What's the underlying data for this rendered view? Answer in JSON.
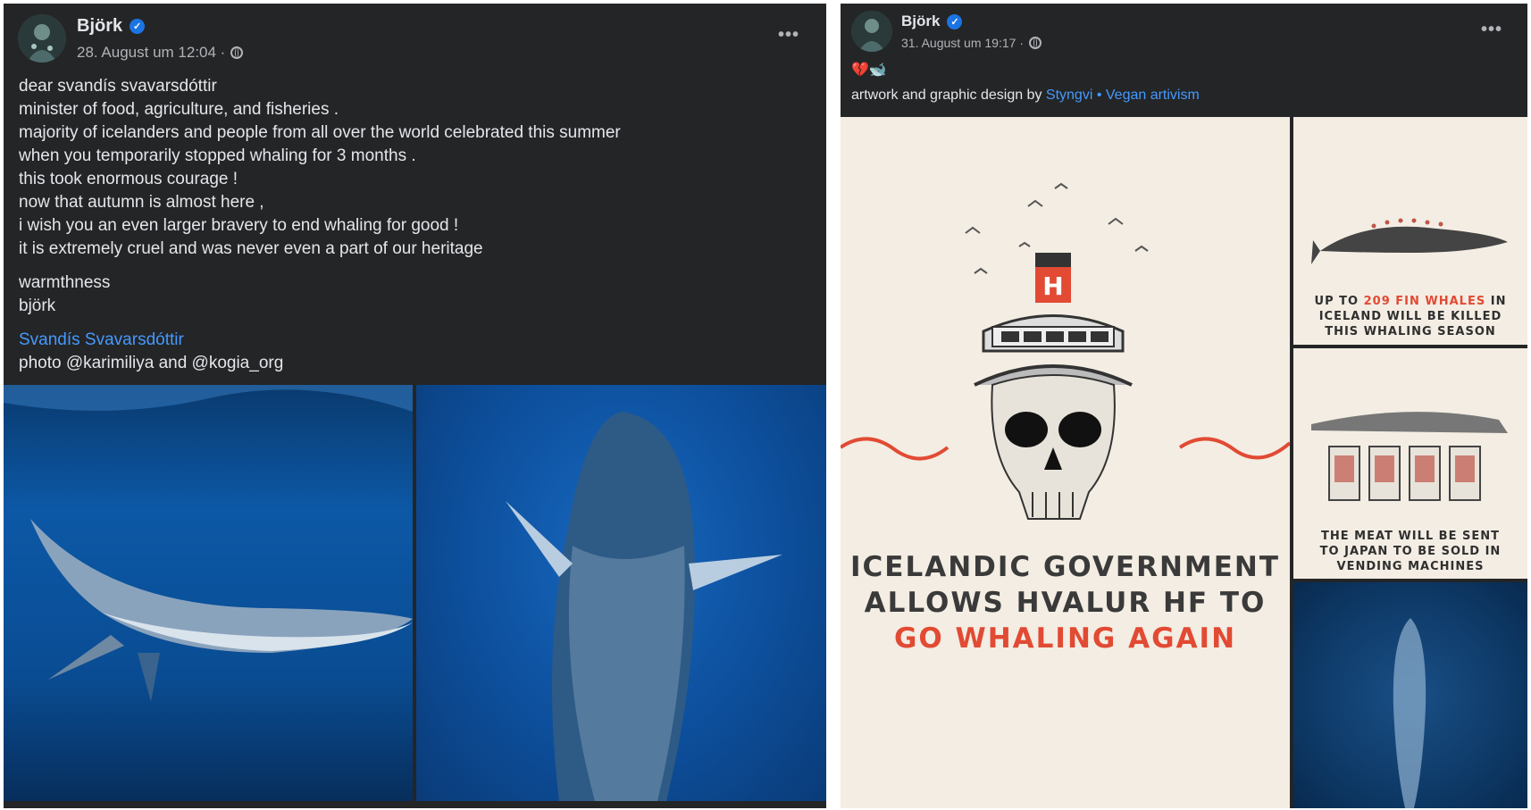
{
  "post1": {
    "author": "Björk",
    "timestamp": "28. August um 12:04 ·",
    "lines": [
      "dear svandís svavarsdóttir",
      "minister of food, agriculture, and fisheries .",
      "majority of icelanders and people from all over the world celebrated this summer",
      "when you temporarily stopped whaling for 3 months .",
      "this took enormous courage !",
      "now that autumn is almost here ,",
      "i wish you an even larger bravery to end whaling for good !",
      "it is extremely cruel and was never even a part of our heritage"
    ],
    "signoff": [
      "warmthness",
      "björk"
    ],
    "tag_link": "Svandís Svavarsdóttir",
    "photo_credit": "photo @karimiliya and @kogia_org"
  },
  "post2": {
    "author": "Björk",
    "timestamp": "31. August um 19:17 ·",
    "emoji": "💔🐋",
    "caption_prefix": "artwork and graphic design by ",
    "caption_link1": "Styngvi",
    "caption_sep": " • ",
    "caption_link2": "Vegan artivism",
    "poster": {
      "ship_letter": "H",
      "line1": "ICELANDIC GOVERNMENT",
      "line2": "ALLOWS HVALUR HF TO",
      "line3": "GO WHALING AGAIN"
    },
    "tile1": {
      "pre": "UP TO ",
      "highlight": "209 FIN WHALES",
      "post": " IN",
      "line2": "ICELAND WILL BE KILLED",
      "line3": "THIS WHALING SEASON"
    },
    "tile2": {
      "line1": "THE MEAT WILL BE SENT",
      "line2": "TO JAPAN TO BE SOLD IN",
      "line3": "VENDING MACHINES"
    }
  },
  "ui": {
    "more_icon": "more-dots-icon",
    "verified_icon": "verified-badge-icon",
    "globe_icon": "globe-icon",
    "accent": "#4599ff",
    "poster_red": "#e24a33"
  }
}
